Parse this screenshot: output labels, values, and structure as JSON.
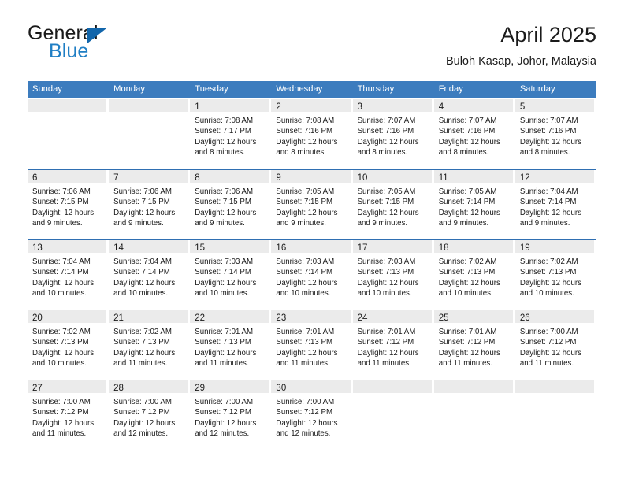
{
  "logo": {
    "word_one": "General",
    "word_two": "Blue",
    "icon": "triangle-logo-icon",
    "accent_dark": "#1266ab",
    "accent_blue": "#1f7ec4"
  },
  "header": {
    "title": "April 2025",
    "subtitle": "Buloh Kasap, Johor, Malaysia"
  },
  "theme": {
    "header_blue": "#3c7cbe",
    "row_rule_blue": "#2f6fb2",
    "day_band_gray": "#ebebeb",
    "text": "#1a1a1a"
  },
  "weekdays": [
    "Sunday",
    "Monday",
    "Tuesday",
    "Wednesday",
    "Thursday",
    "Friday",
    "Saturday"
  ],
  "weeks": [
    [
      {
        "day": "",
        "empty": true
      },
      {
        "day": "",
        "empty": true
      },
      {
        "day": "1",
        "sunrise": "Sunrise: 7:08 AM",
        "sunset": "Sunset: 7:17 PM",
        "daylight_1": "Daylight: 12 hours",
        "daylight_2": "and 8 minutes."
      },
      {
        "day": "2",
        "sunrise": "Sunrise: 7:08 AM",
        "sunset": "Sunset: 7:16 PM",
        "daylight_1": "Daylight: 12 hours",
        "daylight_2": "and 8 minutes."
      },
      {
        "day": "3",
        "sunrise": "Sunrise: 7:07 AM",
        "sunset": "Sunset: 7:16 PM",
        "daylight_1": "Daylight: 12 hours",
        "daylight_2": "and 8 minutes."
      },
      {
        "day": "4",
        "sunrise": "Sunrise: 7:07 AM",
        "sunset": "Sunset: 7:16 PM",
        "daylight_1": "Daylight: 12 hours",
        "daylight_2": "and 8 minutes."
      },
      {
        "day": "5",
        "sunrise": "Sunrise: 7:07 AM",
        "sunset": "Sunset: 7:16 PM",
        "daylight_1": "Daylight: 12 hours",
        "daylight_2": "and 8 minutes."
      }
    ],
    [
      {
        "day": "6",
        "sunrise": "Sunrise: 7:06 AM",
        "sunset": "Sunset: 7:15 PM",
        "daylight_1": "Daylight: 12 hours",
        "daylight_2": "and 9 minutes."
      },
      {
        "day": "7",
        "sunrise": "Sunrise: 7:06 AM",
        "sunset": "Sunset: 7:15 PM",
        "daylight_1": "Daylight: 12 hours",
        "daylight_2": "and 9 minutes."
      },
      {
        "day": "8",
        "sunrise": "Sunrise: 7:06 AM",
        "sunset": "Sunset: 7:15 PM",
        "daylight_1": "Daylight: 12 hours",
        "daylight_2": "and 9 minutes."
      },
      {
        "day": "9",
        "sunrise": "Sunrise: 7:05 AM",
        "sunset": "Sunset: 7:15 PM",
        "daylight_1": "Daylight: 12 hours",
        "daylight_2": "and 9 minutes."
      },
      {
        "day": "10",
        "sunrise": "Sunrise: 7:05 AM",
        "sunset": "Sunset: 7:15 PM",
        "daylight_1": "Daylight: 12 hours",
        "daylight_2": "and 9 minutes."
      },
      {
        "day": "11",
        "sunrise": "Sunrise: 7:05 AM",
        "sunset": "Sunset: 7:14 PM",
        "daylight_1": "Daylight: 12 hours",
        "daylight_2": "and 9 minutes."
      },
      {
        "day": "12",
        "sunrise": "Sunrise: 7:04 AM",
        "sunset": "Sunset: 7:14 PM",
        "daylight_1": "Daylight: 12 hours",
        "daylight_2": "and 9 minutes."
      }
    ],
    [
      {
        "day": "13",
        "sunrise": "Sunrise: 7:04 AM",
        "sunset": "Sunset: 7:14 PM",
        "daylight_1": "Daylight: 12 hours",
        "daylight_2": "and 10 minutes."
      },
      {
        "day": "14",
        "sunrise": "Sunrise: 7:04 AM",
        "sunset": "Sunset: 7:14 PM",
        "daylight_1": "Daylight: 12 hours",
        "daylight_2": "and 10 minutes."
      },
      {
        "day": "15",
        "sunrise": "Sunrise: 7:03 AM",
        "sunset": "Sunset: 7:14 PM",
        "daylight_1": "Daylight: 12 hours",
        "daylight_2": "and 10 minutes."
      },
      {
        "day": "16",
        "sunrise": "Sunrise: 7:03 AM",
        "sunset": "Sunset: 7:14 PM",
        "daylight_1": "Daylight: 12 hours",
        "daylight_2": "and 10 minutes."
      },
      {
        "day": "17",
        "sunrise": "Sunrise: 7:03 AM",
        "sunset": "Sunset: 7:13 PM",
        "daylight_1": "Daylight: 12 hours",
        "daylight_2": "and 10 minutes."
      },
      {
        "day": "18",
        "sunrise": "Sunrise: 7:02 AM",
        "sunset": "Sunset: 7:13 PM",
        "daylight_1": "Daylight: 12 hours",
        "daylight_2": "and 10 minutes."
      },
      {
        "day": "19",
        "sunrise": "Sunrise: 7:02 AM",
        "sunset": "Sunset: 7:13 PM",
        "daylight_1": "Daylight: 12 hours",
        "daylight_2": "and 10 minutes."
      }
    ],
    [
      {
        "day": "20",
        "sunrise": "Sunrise: 7:02 AM",
        "sunset": "Sunset: 7:13 PM",
        "daylight_1": "Daylight: 12 hours",
        "daylight_2": "and 10 minutes."
      },
      {
        "day": "21",
        "sunrise": "Sunrise: 7:02 AM",
        "sunset": "Sunset: 7:13 PM",
        "daylight_1": "Daylight: 12 hours",
        "daylight_2": "and 11 minutes."
      },
      {
        "day": "22",
        "sunrise": "Sunrise: 7:01 AM",
        "sunset": "Sunset: 7:13 PM",
        "daylight_1": "Daylight: 12 hours",
        "daylight_2": "and 11 minutes."
      },
      {
        "day": "23",
        "sunrise": "Sunrise: 7:01 AM",
        "sunset": "Sunset: 7:13 PM",
        "daylight_1": "Daylight: 12 hours",
        "daylight_2": "and 11 minutes."
      },
      {
        "day": "24",
        "sunrise": "Sunrise: 7:01 AM",
        "sunset": "Sunset: 7:12 PM",
        "daylight_1": "Daylight: 12 hours",
        "daylight_2": "and 11 minutes."
      },
      {
        "day": "25",
        "sunrise": "Sunrise: 7:01 AM",
        "sunset": "Sunset: 7:12 PM",
        "daylight_1": "Daylight: 12 hours",
        "daylight_2": "and 11 minutes."
      },
      {
        "day": "26",
        "sunrise": "Sunrise: 7:00 AM",
        "sunset": "Sunset: 7:12 PM",
        "daylight_1": "Daylight: 12 hours",
        "daylight_2": "and 11 minutes."
      }
    ],
    [
      {
        "day": "27",
        "sunrise": "Sunrise: 7:00 AM",
        "sunset": "Sunset: 7:12 PM",
        "daylight_1": "Daylight: 12 hours",
        "daylight_2": "and 11 minutes."
      },
      {
        "day": "28",
        "sunrise": "Sunrise: 7:00 AM",
        "sunset": "Sunset: 7:12 PM",
        "daylight_1": "Daylight: 12 hours",
        "daylight_2": "and 12 minutes."
      },
      {
        "day": "29",
        "sunrise": "Sunrise: 7:00 AM",
        "sunset": "Sunset: 7:12 PM",
        "daylight_1": "Daylight: 12 hours",
        "daylight_2": "and 12 minutes."
      },
      {
        "day": "30",
        "sunrise": "Sunrise: 7:00 AM",
        "sunset": "Sunset: 7:12 PM",
        "daylight_1": "Daylight: 12 hours",
        "daylight_2": "and 12 minutes."
      },
      {
        "day": "",
        "empty": true
      },
      {
        "day": "",
        "empty": true
      },
      {
        "day": "",
        "empty": true
      }
    ]
  ]
}
